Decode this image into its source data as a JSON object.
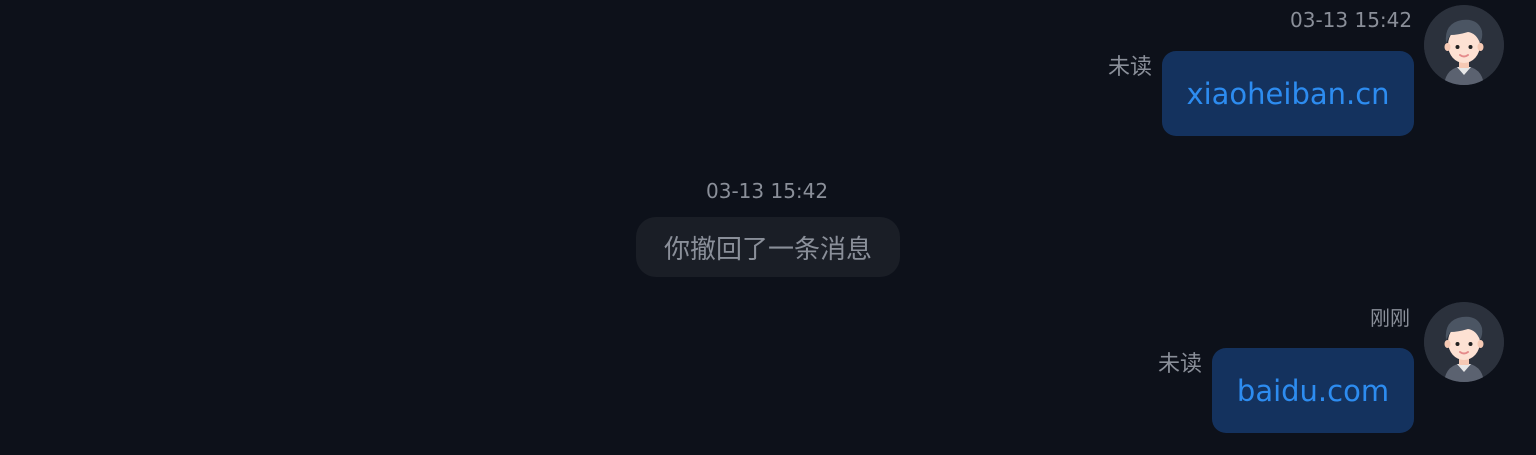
{
  "messages": [
    {
      "type": "outgoing",
      "timestamp": "03-13 15:42",
      "status": "未读",
      "text": "xiaoheiban.cn",
      "avatar_icon": "boy-avatar-icon"
    },
    {
      "type": "system",
      "timestamp": "03-13 15:42",
      "text": "你撤回了一条消息"
    },
    {
      "type": "outgoing",
      "timestamp": "刚刚",
      "status": "未读",
      "text": "baidu.com",
      "avatar_icon": "boy-avatar-icon"
    }
  ],
  "colors": {
    "background": "#0d111a",
    "bubble": "#14325e",
    "link": "#2d8cf0",
    "muted_text": "#8a8f99",
    "system_pill": "#1a1e26"
  }
}
